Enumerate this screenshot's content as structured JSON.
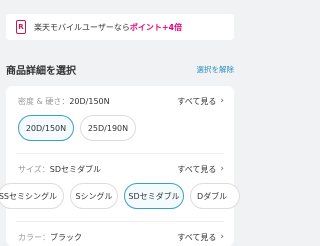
{
  "banner": {
    "icon": "rakuten-mobile-icon",
    "icon_glyph": "R",
    "text_prefix": "楽天モバイルユーザーなら",
    "text_highlight": "ポイント+4倍"
  },
  "section": {
    "title": "商品詳細を選択",
    "clear_label": "選択を解除"
  },
  "density": {
    "label": "密度 & 硬さ：",
    "value": "20D/150N",
    "see_all": "すべて見る",
    "options": [
      "20D/150N",
      "25D/190N"
    ],
    "selected_index": 0
  },
  "size": {
    "label": "サイズ：",
    "value": "SDセミダブル",
    "see_all": "すべて見る",
    "options": [
      "SSセミシングル",
      "Sシングル",
      "SDセミダブル",
      "Dダブル"
    ],
    "selected_index": 2
  },
  "color": {
    "label": "カラー：",
    "value": "ブラック",
    "see_all": "すべて見る"
  },
  "colors": {
    "accent": "#3aa0c8",
    "link": "#2a8fbd",
    "highlight": "#e6007e"
  }
}
